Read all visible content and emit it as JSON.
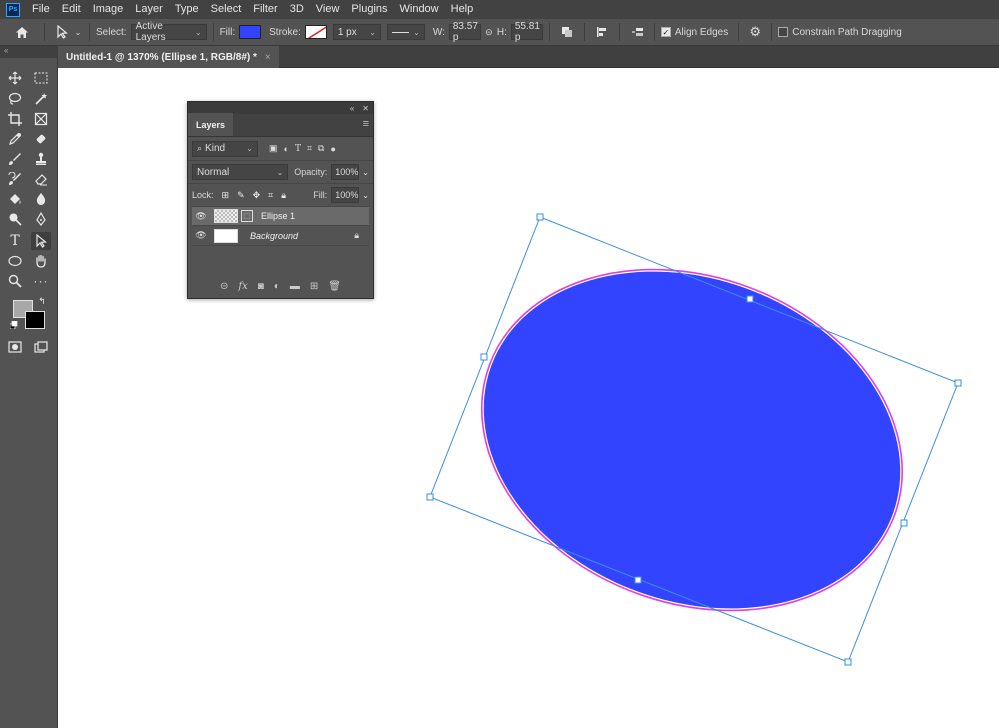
{
  "app": {
    "logo": "Ps"
  },
  "menu": [
    "File",
    "Edit",
    "Image",
    "Layer",
    "Type",
    "Select",
    "Filter",
    "3D",
    "View",
    "Plugins",
    "Window",
    "Help"
  ],
  "options": {
    "select_label": "Select:",
    "select_value": "Active Layers",
    "fill_label": "Fill:",
    "fill_color": "#3344ff",
    "stroke_label": "Stroke:",
    "stroke_width": "1 px",
    "w_label": "W:",
    "w_value": "83.57 p",
    "h_label": "H:",
    "h_value": "55.81 p",
    "align_edges_label": "Align Edges",
    "align_edges_checked": true,
    "constrain_label": "Constrain Path Dragging",
    "constrain_checked": false
  },
  "document": {
    "tab_title": "Untitled-1 @ 1370% (Ellipse 1, RGB/8#) *",
    "close_glyph": "×",
    "shape_color": "#3344ff",
    "path_color": "#e040e0",
    "transform_color": "#3a8ee6"
  },
  "toolbar": {
    "collapse_glyph": "«",
    "tools": [
      "move",
      "marquee",
      "lasso",
      "magic-wand",
      "crop",
      "frame",
      "eyedropper",
      "healing",
      "brush",
      "stamp",
      "history-brush",
      "eraser",
      "paint-bucket",
      "blur",
      "dodge",
      "pen",
      "type",
      "direct-selection",
      "ellipse",
      "hand",
      "zoom",
      "more",
      "quick-mask",
      "screen-mode"
    ]
  },
  "layers_panel": {
    "tab_label": "Layers",
    "filter_label": "Kind",
    "blend_mode": "Normal",
    "opacity_label": "Opacity:",
    "opacity_value": "100%",
    "lock_label": "Lock:",
    "fill_label": "Fill:",
    "fill_value": "100%",
    "layers": [
      {
        "name": "Ellipse 1",
        "selected": true
      },
      {
        "name": "Background",
        "selected": false,
        "locked": true
      }
    ]
  }
}
